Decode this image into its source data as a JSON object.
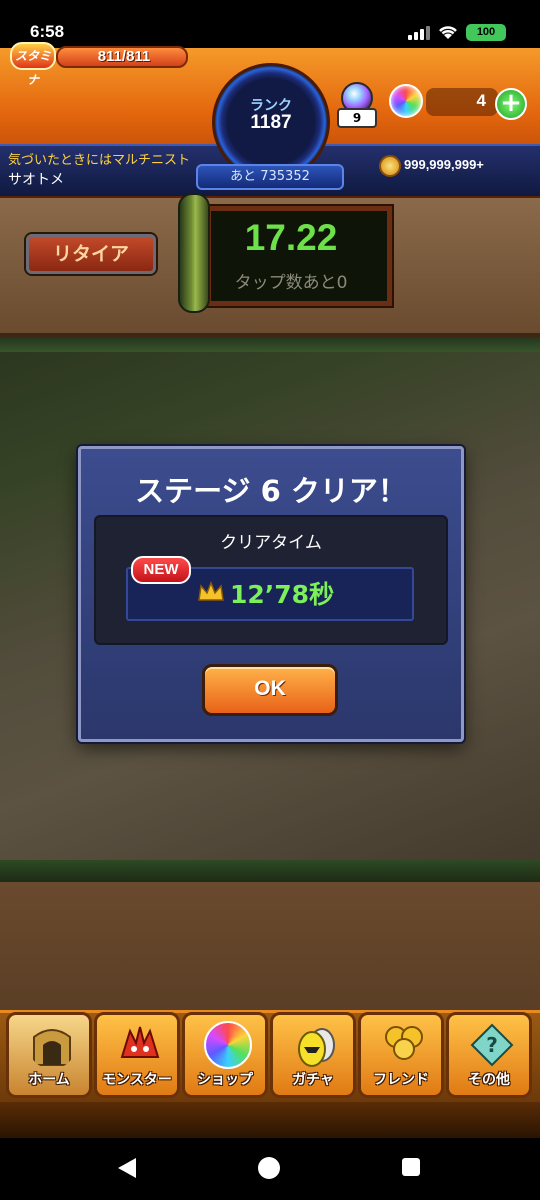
{
  "status_bar": {
    "time": "6:58",
    "battery": "100"
  },
  "hud": {
    "stamina_icon": "スタミナ",
    "stamina": "811/811",
    "rank_label": "ランク",
    "rank": "1187",
    "rank_next": "あと 735352",
    "orb_bag_count": "9",
    "orb_count": "4",
    "add_label": "+",
    "player_title": "気づいたときにはマルチニスト",
    "player_name": "サオトメ",
    "coins": "999,999,999+"
  },
  "stage": {
    "retire_label": "リタイア",
    "timer": "17.22",
    "tap_label": "タップ数あと0"
  },
  "dialog": {
    "title": "ステージ 6 クリア！",
    "clear_label": "クリアタイム",
    "new_badge": "NEW",
    "clear_time": "12’78秒",
    "ok_label": "OK"
  },
  "bottom_nav": {
    "items": [
      {
        "label": "ホーム",
        "icon": "home-gate-icon"
      },
      {
        "label": "モンスター",
        "icon": "monster-icon"
      },
      {
        "label": "ショップ",
        "icon": "orb-shop-icon"
      },
      {
        "label": "ガチャ",
        "icon": "gacha-egg-icon"
      },
      {
        "label": "フレンド",
        "icon": "friend-balloon-icon"
      },
      {
        "label": "その他",
        "icon": "other-icon"
      }
    ]
  },
  "colors": {
    "accent_orange": "#e3660d",
    "panel_blue": "#2b376c",
    "timer_green": "#6ee04a",
    "clear_green": "#7cf05a"
  }
}
